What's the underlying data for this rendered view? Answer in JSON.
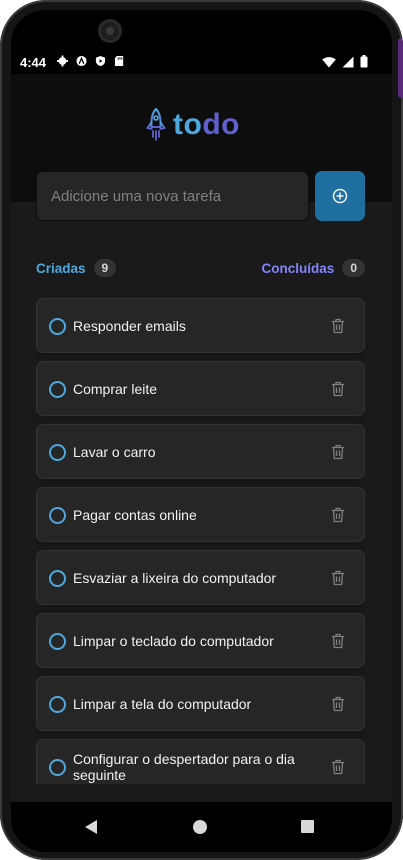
{
  "status_bar": {
    "time": "4:44",
    "left_icons": [
      "settings-icon",
      "a-icon",
      "shield-play-icon",
      "sd-card-icon"
    ],
    "right_icons": [
      "wifi-icon",
      "cell-signal-icon",
      "battery-icon"
    ]
  },
  "header": {
    "logo_icon": "rocket-icon",
    "logo_part1": "to",
    "logo_part2": "do"
  },
  "new_task": {
    "placeholder": "Adicione uma nova tarefa",
    "value": "",
    "add_icon": "plus-circle-icon"
  },
  "counters": {
    "created_label": "Criadas",
    "created_count": "9",
    "done_label": "Concluídas",
    "done_count": "0"
  },
  "tasks": [
    {
      "text": "Responder emails",
      "completed": false
    },
    {
      "text": "Comprar leite",
      "completed": false
    },
    {
      "text": "Lavar o carro",
      "completed": false
    },
    {
      "text": "Pagar contas online",
      "completed": false
    },
    {
      "text": "Esvaziar a lixeira do computador",
      "completed": false
    },
    {
      "text": "Limpar o teclado do computador",
      "completed": false
    },
    {
      "text": "Limpar a tela do computador",
      "completed": false
    },
    {
      "text": "Configurar o despertador para o dia seguinte",
      "completed": false
    }
  ],
  "colors": {
    "blue": "#4ea8de",
    "purple": "#8284fa",
    "button": "#1e6f9f",
    "background": "#1a1a1a",
    "card": "#262626"
  },
  "nav": {
    "icons": [
      "back-icon",
      "home-icon",
      "recents-icon"
    ]
  }
}
